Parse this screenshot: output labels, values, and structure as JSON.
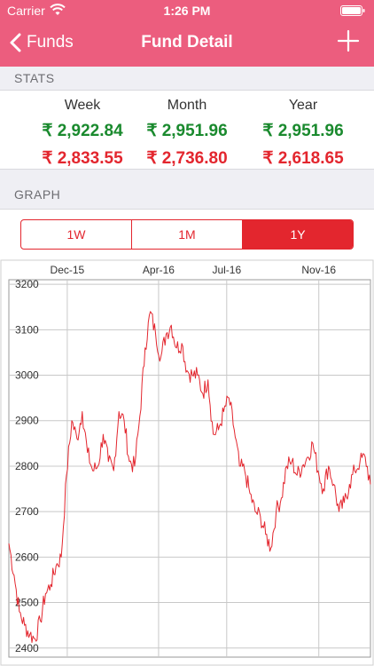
{
  "status_bar": {
    "carrier": "Carrier",
    "time": "1:26 PM"
  },
  "nav": {
    "back_label": "Funds",
    "title": "Fund Detail"
  },
  "sections": {
    "stats": "STATS",
    "graph": "GRAPH"
  },
  "stats": [
    {
      "period": "Week",
      "high": "₹ 2,922.84",
      "low": "₹ 2,833.55"
    },
    {
      "period": "Month",
      "high": "₹ 2,951.96",
      "low": "₹ 2,736.80"
    },
    {
      "period": "Year",
      "high": "₹ 2,951.96",
      "low": "₹ 2,618.65"
    }
  ],
  "segments": [
    {
      "label": "1W",
      "active": false
    },
    {
      "label": "1M",
      "active": false
    },
    {
      "label": "1Y",
      "active": true
    }
  ],
  "colors": {
    "nav": "#ec5d7e",
    "up": "#1a8a2e",
    "down": "#e3262e",
    "line": "#e3262e"
  },
  "chart_data": {
    "type": "line",
    "title": "",
    "xlabel": "",
    "ylabel": "",
    "grid": true,
    "x_ticks": [
      "Dec-15",
      "Apr-16",
      "Jul-16",
      "Nov-16"
    ],
    "y_ticks": [
      2400,
      2500,
      2600,
      2700,
      2800,
      2900,
      3000,
      3100,
      3200
    ],
    "ylim": [
      2380,
      3210
    ],
    "series": [
      {
        "name": "",
        "x": [
          "2015-09-14",
          "2015-09-21",
          "2015-09-28",
          "2015-10-05",
          "2015-10-12",
          "2015-10-19",
          "2015-10-26",
          "2015-11-02",
          "2015-11-09",
          "2015-11-16",
          "2015-11-23",
          "2015-11-30",
          "2015-12-07",
          "2015-12-14",
          "2015-12-21",
          "2015-12-28",
          "2016-01-04",
          "2016-01-11",
          "2016-01-18",
          "2016-01-25",
          "2016-02-01",
          "2016-02-08",
          "2016-02-15",
          "2016-02-22",
          "2016-02-29",
          "2016-03-07",
          "2016-03-14",
          "2016-03-21",
          "2016-03-28",
          "2016-04-04",
          "2016-04-11",
          "2016-04-18",
          "2016-04-25",
          "2016-05-02",
          "2016-05-09",
          "2016-05-16",
          "2016-05-23",
          "2016-05-30",
          "2016-06-06",
          "2016-06-13",
          "2016-06-20",
          "2016-06-27",
          "2016-07-04",
          "2016-07-11",
          "2016-07-18",
          "2016-07-25",
          "2016-08-01",
          "2016-08-08",
          "2016-08-15",
          "2016-08-22",
          "2016-08-29",
          "2016-09-05",
          "2016-09-12",
          "2016-09-19",
          "2016-09-26",
          "2016-10-03",
          "2016-10-10",
          "2016-10-17",
          "2016-10-24",
          "2016-10-31",
          "2016-11-07",
          "2016-11-14",
          "2016-11-21",
          "2016-11-28",
          "2016-12-05",
          "2016-12-12",
          "2016-12-19",
          "2016-12-26",
          "2017-01-02",
          "2017-01-09"
        ],
        "values": [
          2630,
          2560,
          2480,
          2450,
          2430,
          2420,
          2460,
          2520,
          2540,
          2580,
          2600,
          2780,
          2900,
          2860,
          2920,
          2830,
          2790,
          2800,
          2870,
          2810,
          2790,
          2920,
          2900,
          2810,
          2800,
          2910,
          3060,
          3140,
          3090,
          3040,
          3090,
          3110,
          3060,
          3070,
          3010,
          3000,
          3000,
          2960,
          2990,
          2870,
          2880,
          2920,
          2950,
          2880,
          2800,
          2790,
          2740,
          2700,
          2690,
          2650,
          2620,
          2700,
          2730,
          2800,
          2810,
          2780,
          2800,
          2820,
          2850,
          2790,
          2750,
          2800,
          2760,
          2700,
          2720,
          2760,
          2790,
          2810,
          2820,
          2760
        ]
      }
    ]
  }
}
